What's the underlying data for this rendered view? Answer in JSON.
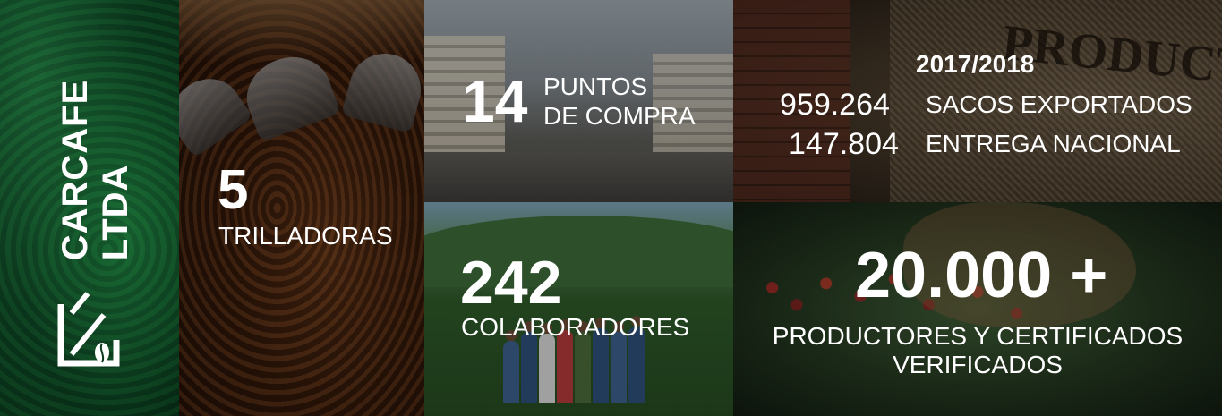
{
  "brand": {
    "name": "CARCAFE LTDA",
    "logo_icon": "carcafe-logo-icon"
  },
  "stats": {
    "trilladoras": {
      "value": "5",
      "label": "TRILLADORAS"
    },
    "puntos": {
      "value": "14",
      "label_line1": "PUNTOS",
      "label_line2": "DE COMPRA"
    },
    "colaboradores": {
      "value": "242",
      "label": "COLABORADORES"
    },
    "export": {
      "year": "2017/2018",
      "rows": [
        {
          "value": "959.264",
          "label": "SACOS EXPORTADOS"
        },
        {
          "value": "147.804",
          "label": "ENTREGA NACIONAL"
        }
      ],
      "sack_print": "PRODUCT"
    },
    "productores": {
      "value": "20.000 +",
      "label": "PRODUCTORES Y CERTIFICADOS VERIFICADOS"
    }
  },
  "colors": {
    "text": "#ffffff",
    "brand_green": "#0c3a1f"
  }
}
